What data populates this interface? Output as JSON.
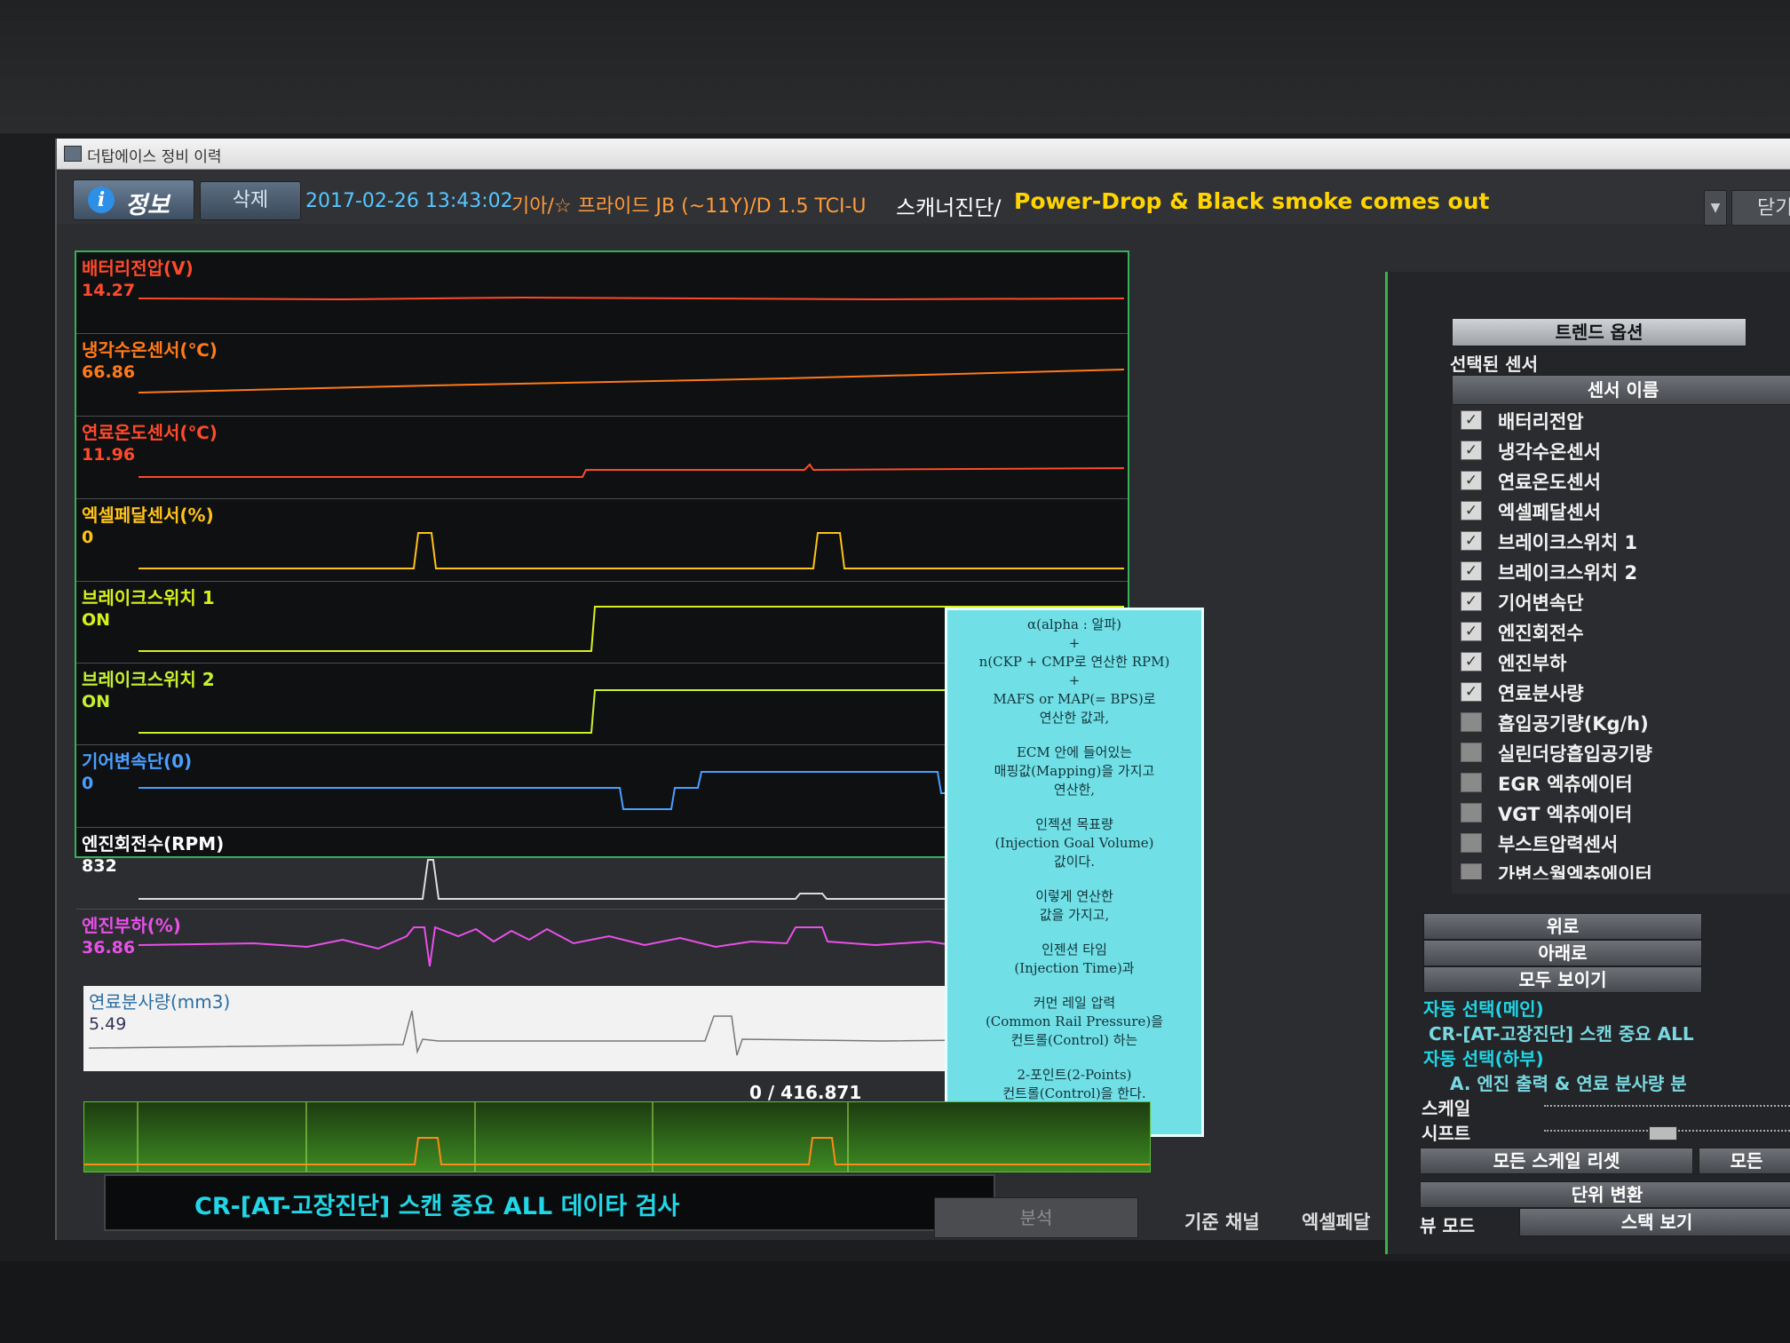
{
  "window": {
    "title": "더탑에이스 정비 이력"
  },
  "toolbar": {
    "info_label": "정보",
    "delete_label": "삭제",
    "date": "2017-02-26 13:43:02",
    "vehicle": "기아/☆ 프라이드 JB (~11Y)/D 1.5 TCI-U",
    "category": "스캐너진단/",
    "description": "Power-Drop & Black smoke comes out",
    "close_label": "닫기"
  },
  "channels": [
    {
      "name": "배터리전압(V)",
      "value": "14.27",
      "color": "#ff4a2a"
    },
    {
      "name": "냉각수온센서(℃)",
      "value": "66.86",
      "color": "#ff7a1a"
    },
    {
      "name": "연료온도센서(℃)",
      "value": "11.96",
      "color": "#ff4a2a"
    },
    {
      "name": "엑셀페달센서(%)",
      "value": "0",
      "color": "#ffc21a"
    },
    {
      "name": "브레이크스위치 1",
      "value": "ON",
      "color": "#d8f01a"
    },
    {
      "name": "브레이크스위치 2",
      "value": "ON",
      "color": "#c8f030"
    },
    {
      "name": "기어변속단(0)",
      "value": "0",
      "color": "#4aa0ff"
    },
    {
      "name": "엔진회전수(RPM)",
      "value": "832",
      "color": "#ffffff"
    },
    {
      "name": "엔진부하(%)",
      "value": "36.86",
      "color": "#e850e8"
    }
  ],
  "fuel_channel": {
    "name": "연료분사량(mm3)",
    "value": "5.49"
  },
  "note": {
    "lines": [
      "α(alpha : 알파)\n+\nn(CKP + CMP로 연산한 RPM)\n+\nMAFS or MAP(= BPS)로\n연산한 값과,",
      "ECM 안에 들어있는\n매핑값(Mapping)을 가지고\n연산한,",
      "인젝션 목표량\n(Injection Goal Volume)\n값이다.",
      "이렇게 연산한\n값을 가지고,",
      "인젠션 타임\n(Injection Time)과",
      "커먼 레일 압력\n(Common Rail Pressure)을\n컨트롤(Control) 하는",
      "2-포인트(2-Points)\n컨트롤(Control)을 한다."
    ]
  },
  "position_label": "0 / 416.871",
  "status": {
    "text": "CR-[AT-고장진단] 스캔 중요 ALL 데이타 검사"
  },
  "analyze_label": "분석",
  "reference": {
    "label": "기준 채널",
    "value": "엑셀페달"
  },
  "side": {
    "trend_options_label": "트렌드 옵션",
    "selected_sensor_label": "선택된 센서",
    "sensor_name_header": "센서 이름",
    "sensors": [
      {
        "name": "배터리전압",
        "checked": true
      },
      {
        "name": "냉각수온센서",
        "checked": true
      },
      {
        "name": "연료온도센서",
        "checked": true
      },
      {
        "name": "엑셀페달센서",
        "checked": true
      },
      {
        "name": "브레이크스위치 1",
        "checked": true
      },
      {
        "name": "브레이크스위치 2",
        "checked": true
      },
      {
        "name": "기어변속단",
        "checked": true
      },
      {
        "name": "엔진회전수",
        "checked": true
      },
      {
        "name": "엔진부하",
        "checked": true
      },
      {
        "name": "연료분사량",
        "checked": true
      },
      {
        "name": "흡입공기량(Kg/h)",
        "checked": false
      },
      {
        "name": "실린더당흡입공기량",
        "checked": false
      },
      {
        "name": "EGR 엑츄에이터",
        "checked": false
      },
      {
        "name": "VGT 엑츄에이터",
        "checked": false
      },
      {
        "name": "부스트압력센서",
        "checked": false
      },
      {
        "name": "가변스월엑츄에이터",
        "checked": false
      }
    ],
    "up_label": "위로",
    "down_label": "아래로",
    "show_all_label": "모두 보이기",
    "auto_main_label": "자동 선택(메인)",
    "auto_main_value": "CR-[AT-고장진단] 스캔 중요 ALL",
    "auto_sub_label": "자동 선택(하부)",
    "auto_sub_value": "A. 엔진 출력 & 연료 분사량 분",
    "scale_label": "스케일",
    "shift_label": "시프트",
    "reset_scale_label": "모든 스케일 리셋",
    "all_label": "모든",
    "unit_convert_label": "단위 변환",
    "view_mode_label": "뷰 모드",
    "stack_view_label": "스택 보기"
  }
}
